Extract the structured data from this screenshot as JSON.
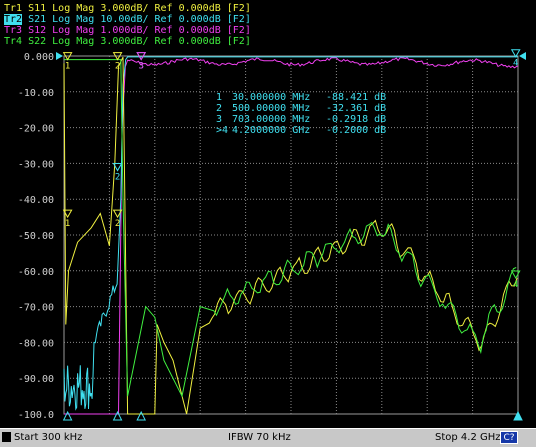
{
  "traces": [
    {
      "label": "Tr1",
      "param": "S11",
      "format": "Log Mag",
      "scale": "3.000dB/",
      "ref": "Ref 0.000dB",
      "tag": "[F2]",
      "color": "#f0f040",
      "active": false
    },
    {
      "label": "Tr2",
      "param": "S21",
      "format": "Log Mag",
      "scale": "10.00dB/",
      "ref": "Ref 0.000dB",
      "tag": "[F2]",
      "color": "#40e0f0",
      "active": true
    },
    {
      "label": "Tr3",
      "param": "S12",
      "format": "Log Mag",
      "scale": "1.000dB/",
      "ref": "Ref 0.000dB",
      "tag": "[F2]",
      "color": "#f040f0",
      "active": false
    },
    {
      "label": "Tr4",
      "param": "S22",
      "format": "Log Mag",
      "scale": "3.000dB/",
      "ref": "Ref 0.000dB",
      "tag": "[F2]",
      "color": "#40f040",
      "active": false
    }
  ],
  "y_axis": {
    "ticks": [
      "0.000",
      "-10.00",
      "-20.00",
      "-30.00",
      "-40.00",
      "-50.00",
      "-60.00",
      "-70.00",
      "-80.00",
      "-90.00",
      "-100.0"
    ],
    "ref_color": "#40e0f0"
  },
  "markers": [
    {
      "id": "1",
      "prefix": " ",
      "freq": "30.000000",
      "unit": "MHz",
      "value": "-88.421 dB"
    },
    {
      "id": "2",
      "prefix": " ",
      "freq": "500.00000",
      "unit": "MHz",
      "value": "-32.361 dB"
    },
    {
      "id": "3",
      "prefix": " ",
      "freq": "703.00000",
      "unit": "MHz",
      "value": "-0.2918 dB"
    },
    {
      "id": "4",
      "prefix": ">",
      "freq": "4.2000000",
      "unit": "GHz",
      "value": "-0.2000 dB"
    }
  ],
  "status_bar": {
    "start": "Start 300 kHz",
    "ifbw": "IFBW 70 kHz",
    "stop": "Stop 4.2 GHz",
    "cal": "C?"
  },
  "chart_data": {
    "type": "line",
    "x_range": [
      "300 kHz",
      "4.2 GHz"
    ],
    "ylim": [
      -100,
      0
    ],
    "grid": true,
    "series": [
      {
        "name": "S11",
        "color": "#f0f040"
      },
      {
        "name": "S21",
        "color": "#40e0f0"
      },
      {
        "name": "S12",
        "color": "#f040f0"
      },
      {
        "name": "S22",
        "color": "#40f040"
      }
    ]
  }
}
